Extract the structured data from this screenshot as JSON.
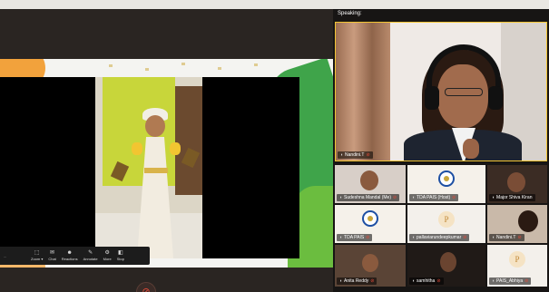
{
  "speaking": {
    "label": "Speaking:"
  },
  "speaker": {
    "name": "Nandini.T"
  },
  "toolbar": {
    "left_text": "...",
    "items": [
      {
        "icon": "⬚",
        "label": "Zoom ▾"
      },
      {
        "icon": "✉",
        "label": "Chat"
      },
      {
        "icon": "☻",
        "label": "Reactions"
      },
      {
        "icon": "✎",
        "label": "Annotate"
      },
      {
        "icon": "⚙",
        "label": "More"
      },
      {
        "icon": "◧",
        "label": "Stop"
      }
    ]
  },
  "participants": [
    {
      "name": "Sudeshna Mandal (Me)",
      "type": "photo"
    },
    {
      "name": "TDA PAIS (Host)",
      "type": "logo"
    },
    {
      "name": "Major Shiva Kiran",
      "type": "video"
    },
    {
      "name": "TDA PAIS",
      "type": "logo"
    },
    {
      "name": "pallaviarundeepkumar",
      "type": "avatar",
      "avatar_letter": "P"
    },
    {
      "name": "Nandini.T",
      "type": "video"
    },
    {
      "name": "Anita Reddy",
      "type": "video"
    },
    {
      "name": "samhitha",
      "type": "video"
    },
    {
      "name": "PAIS_Abhiya",
      "type": "avatar",
      "avatar_letter": "P"
    }
  ],
  "colors": {
    "highlight": "#f2c533",
    "mic_muted": "#e24b3a",
    "toolbar_bg": "#1c1c1c"
  }
}
